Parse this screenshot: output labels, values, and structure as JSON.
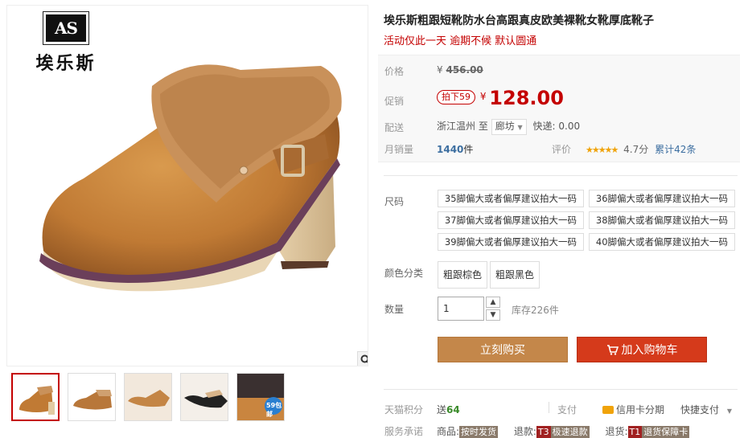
{
  "brand": {
    "logo_mark": "AS",
    "name": "埃乐斯"
  },
  "product": {
    "title": "埃乐斯粗跟短靴防水台高跟真皮欧美裸靴女靴厚底靴子",
    "subtitle": "活动仅此一天 逾期不候 默认圆通"
  },
  "price": {
    "label": "价格",
    "currency": "¥",
    "original": "456.00",
    "promo_label": "促销",
    "promo_tag": "拍下59",
    "promo_price": "128.00"
  },
  "shipping": {
    "label": "配送",
    "from": "浙江温州",
    "to_word": "至",
    "dest": "廊坊",
    "express": "快递: 0.00"
  },
  "sales": {
    "label": "月销量",
    "value": "1440",
    "unit": "件"
  },
  "rating": {
    "label": "评价",
    "stars": "★★★★★",
    "score": "4.7分",
    "count": "累计42条"
  },
  "size": {
    "label": "尺码",
    "options": [
      "35脚偏大或者偏厚建议拍大一码",
      "36脚偏大或者偏厚建议拍大一码",
      "37脚偏大或者偏厚建议拍大一码",
      "38脚偏大或者偏厚建议拍大一码",
      "39脚偏大或者偏厚建议拍大一码",
      "40脚偏大或者偏厚建议拍大一码"
    ]
  },
  "color": {
    "label": "颜色分类",
    "options": [
      "粗跟棕色",
      "粗跟黑色"
    ]
  },
  "quantity": {
    "label": "数量",
    "value": "1",
    "stock": "库存226件"
  },
  "actions": {
    "buy": "立刻购买",
    "cart": "加入购物车"
  },
  "points": {
    "label": "天猫积分",
    "prefix": "送",
    "value": "64"
  },
  "payment": {
    "label": "支付",
    "credit": "信用卡分期",
    "quick": "快捷支付"
  },
  "service": {
    "label": "服务承诺",
    "items": [
      {
        "name": "商品:",
        "badge": "按时发货"
      },
      {
        "name": "退款:",
        "code": "T3",
        "badge": "极速退款"
      },
      {
        "name": "退货:",
        "code": "T1",
        "badge": "退货保障卡"
      }
    ]
  },
  "gallery": {
    "thumb_badge": "59包邮"
  },
  "colors": {
    "accent": "#c40000",
    "buy": "#c4874a",
    "cart": "#d53a1b",
    "rating": "#f0a30a"
  }
}
